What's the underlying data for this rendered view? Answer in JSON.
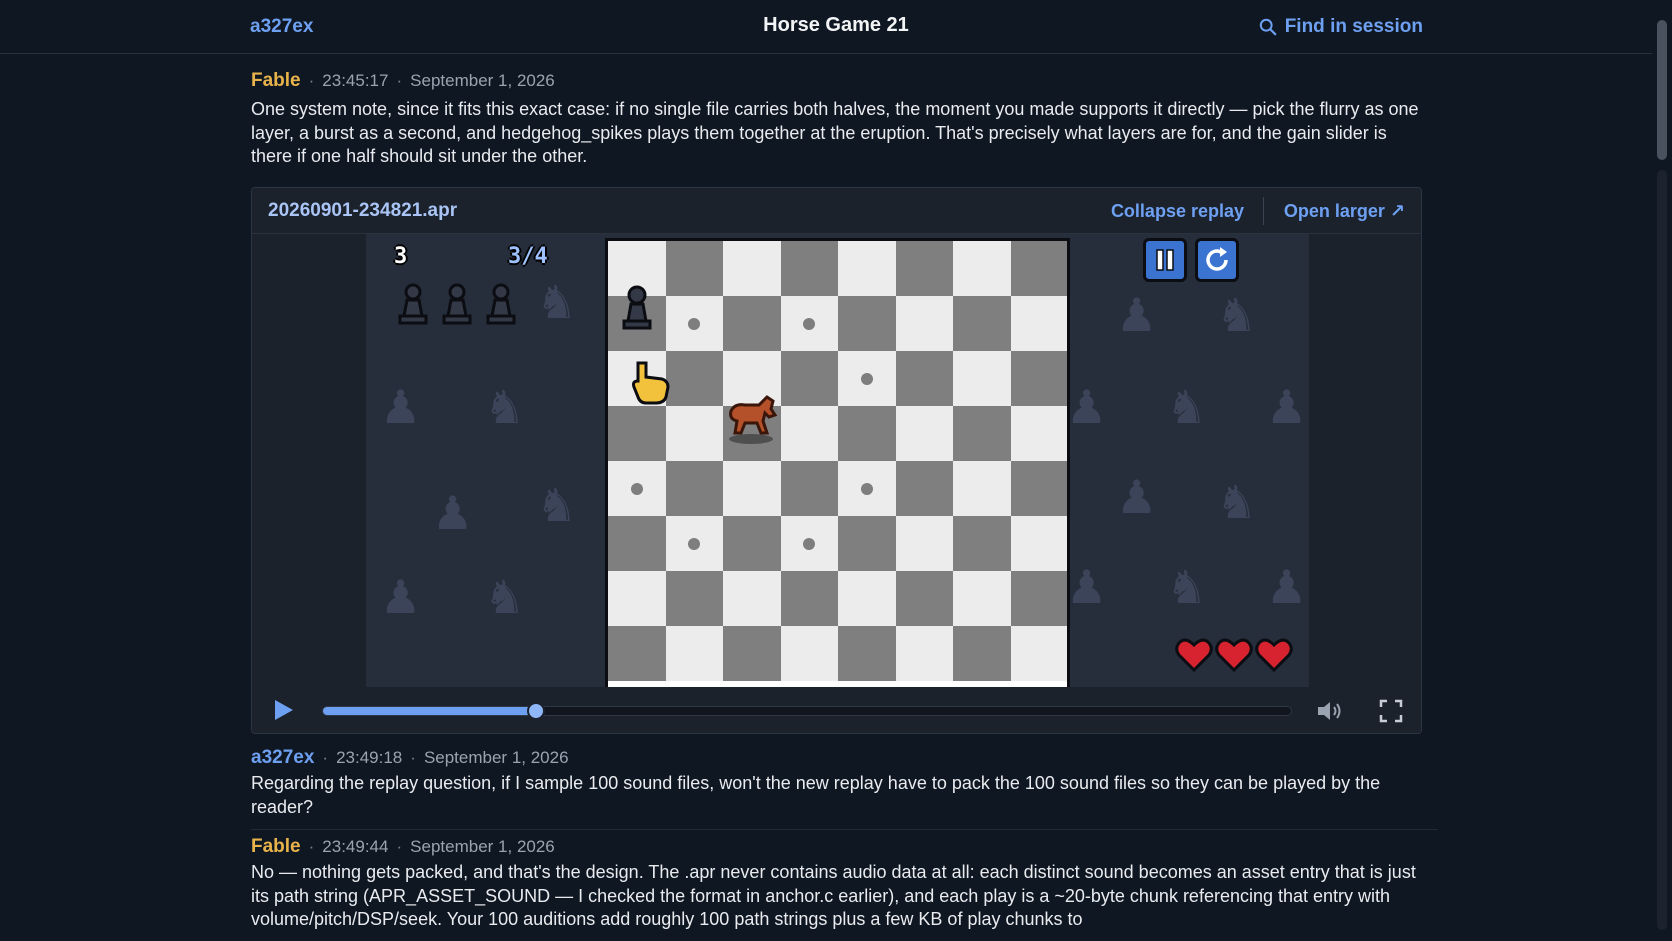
{
  "header": {
    "user": "a327ex",
    "title": "Horse Game 21",
    "find_label": "Find in session"
  },
  "messages": [
    {
      "author": "Fable",
      "time": "23:45:17",
      "date": "September 1, 2026",
      "text": "One system note, since it fits this exact case: if no single file carries both halves, the moment you made supports it directly — pick the flurry as one layer, a burst as a second, and hedgehog_spikes plays them together at the eruption. That's precisely what layers are for, and the gain slider is there if one half should sit under the other."
    },
    {
      "author": "a327ex",
      "time": "23:49:18",
      "date": "September 1, 2026",
      "text": "Regarding the replay question, if I sample 100 sound files, won't the new replay have to pack the 100 sound files so they can be played by the reader?"
    },
    {
      "author": "Fable",
      "time": "23:49:44",
      "date": "September 1, 2026",
      "text": "No — nothing gets packed, and that's the design. The .apr never contains audio data at all: each distinct sound becomes an asset entry that is just its path string (APR_ASSET_SOUND — I checked the format in anchor.c earlier), and each play is a ~20-byte chunk referencing that entry with volume/pitch/DSP/seek. Your 100 auditions add roughly 100 path strings plus a few KB of play chunks to"
    }
  ],
  "replay": {
    "filename": "20260901-234821.apr",
    "collapse_label": "Collapse replay",
    "open_label": "Open larger ↗",
    "progress": 0.22,
    "hud": {
      "score": "3",
      "fraction": "3/4",
      "pawns_remaining": 3,
      "hearts": 3
    },
    "colors": {
      "accent": "#6ea0f2",
      "fable": "#e8b34a"
    },
    "icons": {
      "pause": "pause-icon",
      "restart": "restart-icon",
      "play": "play-icon",
      "volume": "volume-icon",
      "fullscreen": "fullscreen-icon"
    }
  }
}
